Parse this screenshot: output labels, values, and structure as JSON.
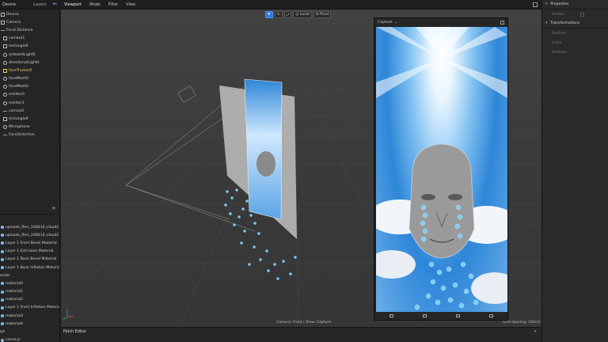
{
  "left_panel": {
    "tabs": [
      "Device",
      "Layers"
    ],
    "scene_items": [
      {
        "label": "Device",
        "icon": "device-icon"
      },
      {
        "label": "Camera",
        "icon": "camera-icon"
      },
      {
        "label": "Focal Distance",
        "icon": "focal-icon"
      },
      {
        "label": "camera1",
        "icon": "camera-icon"
      },
      {
        "label": "rectangle0",
        "icon": "rectangle-icon"
      },
      {
        "label": "ambientLight0",
        "icon": "light-icon"
      },
      {
        "label": "directionalLight0",
        "icon": "light-icon"
      },
      {
        "label": "faceTracker0",
        "icon": "face-tracker-icon",
        "highlight": true
      },
      {
        "label": "faceMesh0",
        "icon": "mesh-icon"
      },
      {
        "label": "faceMesh0",
        "icon": "mesh-icon"
      },
      {
        "label": "emitter0",
        "icon": "emitter-icon"
      },
      {
        "label": "emitter1",
        "icon": "emitter-icon"
      },
      {
        "label": "canvas0",
        "icon": "canvas-icon"
      },
      {
        "label": "rectangle0",
        "icon": "rectangle-icon"
      },
      {
        "label": "Microphone",
        "icon": "microphone-icon"
      },
      {
        "label": "FaceDistortion",
        "icon": "distortion-icon"
      }
    ],
    "asset_items": [
      {
        "label": "uploads_files_248410_cloud2",
        "icon": "texture-icon"
      },
      {
        "label": "uploads_files_248410_cloud2",
        "icon": "texture-icon"
      },
      {
        "label": "Layer 1 Front Bevel Material",
        "icon": "material-icon"
      },
      {
        "label": "Layer 1 Extrusion Material",
        "icon": "material-icon"
      },
      {
        "label": "Layer 1 Back Bevel Material",
        "icon": "material-icon"
      },
      {
        "label": "Layer 1 Back Inflation Material",
        "icon": "material-icon"
      },
      {
        "label": "erials",
        "icon": "none"
      },
      {
        "label": "material0",
        "icon": "material-icon"
      },
      {
        "label": "material1",
        "icon": "material-icon"
      },
      {
        "label": "material2",
        "icon": "material-icon"
      },
      {
        "label": "Layer 1 Front Inflation Material",
        "icon": "material-icon"
      },
      {
        "label": "material3",
        "icon": "material-icon"
      },
      {
        "label": "material4",
        "icon": "material-icon"
      },
      {
        "label": "ipt",
        "icon": "none"
      },
      {
        "label": "cense.js",
        "icon": "script-icon"
      }
    ],
    "add_label": "+"
  },
  "menubar": {
    "items": [
      "Viewport",
      "Mode",
      "Filter",
      "View"
    ]
  },
  "viewport": {
    "toolbar": {
      "local_label": "Local",
      "pivot_label": "Pivot"
    },
    "status": "Camera: Front | View: Capture",
    "grid_spacing": "Grid spacing: 100cm"
  },
  "capture": {
    "title": "Capture"
  },
  "properties": {
    "heading": "Properties",
    "visible_label": "Visible",
    "transform_heading": "Transformations",
    "rows": [
      "Position",
      "Scale",
      "Rotation"
    ]
  },
  "patch_editor": {
    "title": "Patch Editor"
  },
  "colors": {
    "accent": "#2d79d8",
    "highlight": "#e8d36a",
    "sky": "#2e86d8"
  }
}
